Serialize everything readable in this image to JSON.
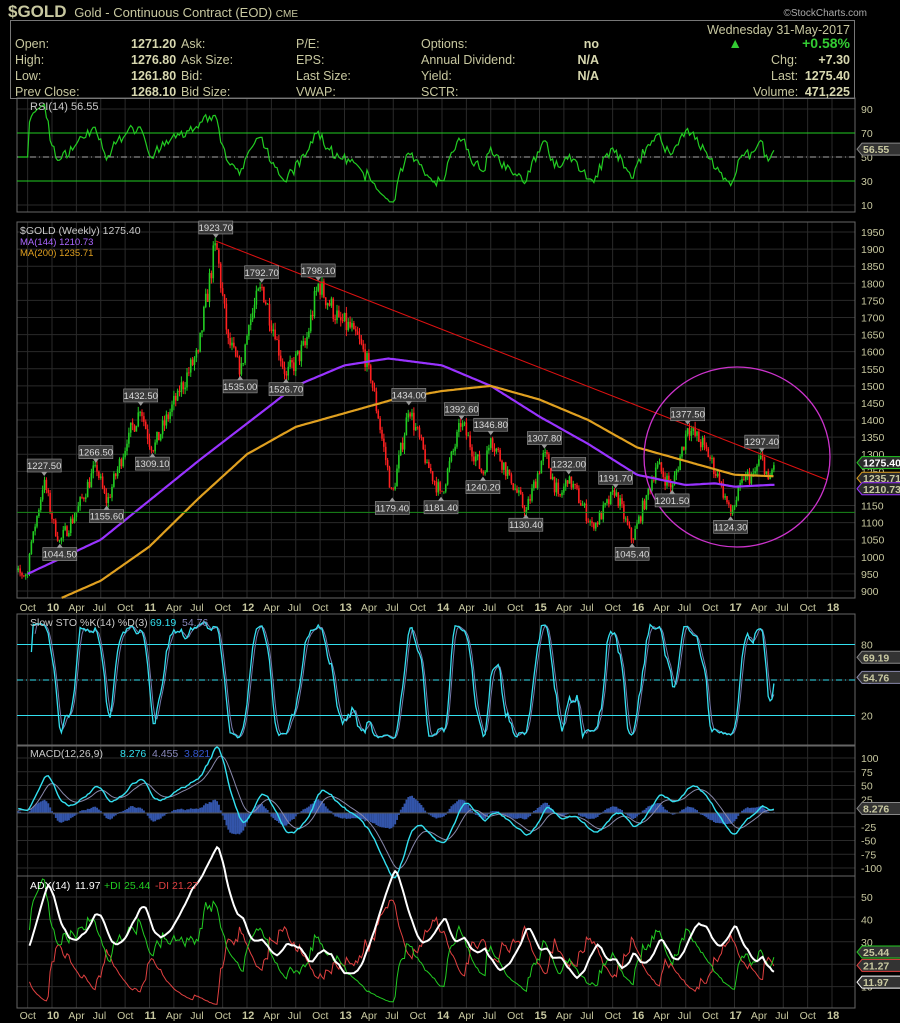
{
  "header": {
    "symbol": "$GOLD",
    "name": "Gold - Continuous Contract (EOD)",
    "exchange": "CME",
    "brand": "©StockCharts.com",
    "date": "Wednesday  31-May-2017",
    "pct_change": "+0.58%",
    "fields": [
      {
        "label": "Open:",
        "value": "1271.20"
      },
      {
        "label": "High:",
        "value": "1276.80"
      },
      {
        "label": "Low:",
        "value": "1261.80"
      },
      {
        "label": "Prev Close:",
        "value": "1268.10"
      },
      {
        "label": "Ask:",
        "value": ""
      },
      {
        "label": "Ask Size:",
        "value": ""
      },
      {
        "label": "Bid:",
        "value": ""
      },
      {
        "label": "Bid Size:",
        "value": ""
      },
      {
        "label": "P/E:",
        "value": ""
      },
      {
        "label": "EPS:",
        "value": ""
      },
      {
        "label": "Last Size:",
        "value": ""
      },
      {
        "label": "VWAP:",
        "value": ""
      },
      {
        "label": "Options:",
        "value": "no"
      },
      {
        "label": "Annual Dividend:",
        "value": "N/A"
      },
      {
        "label": "Yield:",
        "value": "N/A"
      },
      {
        "label": "SCTR:",
        "value": ""
      },
      {
        "label": "Chg:",
        "value": "+7.30"
      },
      {
        "label": "Last:",
        "value": "1275.40"
      },
      {
        "label": "Volume:",
        "value": "471,225"
      }
    ]
  },
  "colors": {
    "up": "#22cc22",
    "down": "#ff2020",
    "ma144": "#9933ff",
    "ma200": "#e0a020",
    "rsi": "#22cc22",
    "sto": "#33e0f0",
    "macd": "#33e0f0",
    "hist": "#3355aa",
    "adx": "#ffffff",
    "pdi": "#22cc22",
    "mdi": "#e04040",
    "trend": "#dd1111",
    "circle": "#cc33cc"
  },
  "chart_data": {
    "type": "line",
    "title": "$GOLD (Weekly) 1275.40",
    "x_ticks": [
      {
        "t": 2009.75,
        "label": "Oct"
      },
      {
        "t": 2010.0,
        "label": "10"
      },
      {
        "t": 2010.25,
        "label": "Apr"
      },
      {
        "t": 2010.5,
        "label": "Jul"
      },
      {
        "t": 2010.75,
        "label": "Oct"
      },
      {
        "t": 2011.0,
        "label": "11"
      },
      {
        "t": 2011.25,
        "label": "Apr"
      },
      {
        "t": 2011.5,
        "label": "Jul"
      },
      {
        "t": 2011.75,
        "label": "Oct"
      },
      {
        "t": 2012.0,
        "label": "12"
      },
      {
        "t": 2012.25,
        "label": "Apr"
      },
      {
        "t": 2012.5,
        "label": "Jul"
      },
      {
        "t": 2012.75,
        "label": "Oct"
      },
      {
        "t": 2013.0,
        "label": "13"
      },
      {
        "t": 2013.25,
        "label": "Apr"
      },
      {
        "t": 2013.5,
        "label": "Jul"
      },
      {
        "t": 2013.75,
        "label": "Oct"
      },
      {
        "t": 2014.0,
        "label": "14"
      },
      {
        "t": 2014.25,
        "label": "Apr"
      },
      {
        "t": 2014.5,
        "label": "Jul"
      },
      {
        "t": 2014.75,
        "label": "Oct"
      },
      {
        "t": 2015.0,
        "label": "15"
      },
      {
        "t": 2015.25,
        "label": "Apr"
      },
      {
        "t": 2015.5,
        "label": "Jul"
      },
      {
        "t": 2015.75,
        "label": "Oct"
      },
      {
        "t": 2016.0,
        "label": "16"
      },
      {
        "t": 2016.25,
        "label": "Apr"
      },
      {
        "t": 2016.5,
        "label": "Jul"
      },
      {
        "t": 2016.75,
        "label": "Oct"
      },
      {
        "t": 2017.0,
        "label": "17"
      },
      {
        "t": 2017.25,
        "label": "Apr"
      },
      {
        "t": 2017.5,
        "label": "Jul"
      },
      {
        "t": 2017.75,
        "label": "Oct"
      },
      {
        "t": 2018.0,
        "label": "18"
      }
    ],
    "panels": {
      "rsi": {
        "legend": "RSI(14) 56.55",
        "ticks": [
          90,
          70,
          50,
          30,
          10
        ],
        "last": "56.55",
        "ylim": [
          0,
          100
        ]
      },
      "price": {
        "legend": "$GOLD (Weekly) 1275.40",
        "ma144_legend": "MA(144) 1210.73",
        "ma200_legend": "MA(200) 1235.71",
        "ticks": [
          1950,
          1900,
          1850,
          1800,
          1750,
          1700,
          1650,
          1600,
          1550,
          1500,
          1450,
          1400,
          1350,
          1300,
          1250,
          1200,
          1150,
          1100,
          1050,
          1000,
          950,
          900
        ],
        "ylim": [
          880,
          1960
        ],
        "last_labels": {
          "close": "1275.40",
          "ma200": "1235.71",
          "ma144": "1210.73"
        },
        "closes_key": [
          [
            2009.75,
            1000
          ],
          [
            2009.82,
            1080
          ],
          [
            2009.92,
            1227.5
          ],
          [
            2010.0,
            1110
          ],
          [
            2010.08,
            1044.5
          ],
          [
            2010.25,
            1130
          ],
          [
            2010.45,
            1266.5
          ],
          [
            2010.56,
            1155.6
          ],
          [
            2010.78,
            1350
          ],
          [
            2010.91,
            1432.5
          ],
          [
            2011.03,
            1309.1
          ],
          [
            2011.3,
            1480
          ],
          [
            2011.5,
            1600
          ],
          [
            2011.68,
            1923.7
          ],
          [
            2011.8,
            1640
          ],
          [
            2011.93,
            1535
          ],
          [
            2012.02,
            1680
          ],
          [
            2012.15,
            1792.7
          ],
          [
            2012.3,
            1640
          ],
          [
            2012.4,
            1526.7
          ],
          [
            2012.6,
            1620
          ],
          [
            2012.73,
            1798.1
          ],
          [
            2012.95,
            1690
          ],
          [
            2013.1,
            1660
          ],
          [
            2013.25,
            1560
          ],
          [
            2013.35,
            1400
          ],
          [
            2013.49,
            1179.4
          ],
          [
            2013.66,
            1434
          ],
          [
            2013.85,
            1270
          ],
          [
            2013.99,
            1181.4
          ],
          [
            2014.2,
            1392.6
          ],
          [
            2014.42,
            1240.2
          ],
          [
            2014.5,
            1346.8
          ],
          [
            2014.7,
            1230
          ],
          [
            2014.86,
            1130.4
          ],
          [
            2015.05,
            1307.8
          ],
          [
            2015.2,
            1170
          ],
          [
            2015.3,
            1232
          ],
          [
            2015.55,
            1085
          ],
          [
            2015.78,
            1191.7
          ],
          [
            2015.95,
            1045.4
          ],
          [
            2016.1,
            1180
          ],
          [
            2016.2,
            1270
          ],
          [
            2016.36,
            1201.5
          ],
          [
            2016.52,
            1377.5
          ],
          [
            2016.7,
            1320
          ],
          [
            2016.85,
            1220
          ],
          [
            2016.96,
            1124.3
          ],
          [
            2017.1,
            1230
          ],
          [
            2017.2,
            1240
          ],
          [
            2017.28,
            1297.4
          ],
          [
            2017.35,
            1220
          ],
          [
            2017.41,
            1275.4
          ]
        ],
        "ma144_key": [
          [
            2009.75,
            950
          ],
          [
            2010.5,
            1050
          ],
          [
            2011.5,
            1280
          ],
          [
            2012.5,
            1500
          ],
          [
            2013.0,
            1560
          ],
          [
            2013.45,
            1580
          ],
          [
            2014.0,
            1560
          ],
          [
            2014.5,
            1500
          ],
          [
            2015.0,
            1410
          ],
          [
            2015.5,
            1330
          ],
          [
            2016.0,
            1240
          ],
          [
            2016.5,
            1210
          ],
          [
            2016.8,
            1215
          ],
          [
            2017.0,
            1205
          ],
          [
            2017.41,
            1210.73
          ]
        ],
        "ma200_key": [
          [
            2010.1,
            880
          ],
          [
            2010.5,
            930
          ],
          [
            2011.0,
            1030
          ],
          [
            2011.5,
            1170
          ],
          [
            2012.0,
            1300
          ],
          [
            2012.5,
            1380
          ],
          [
            2013.0,
            1420
          ],
          [
            2013.5,
            1460
          ],
          [
            2014.0,
            1485
          ],
          [
            2014.5,
            1500
          ],
          [
            2015.0,
            1460
          ],
          [
            2015.5,
            1400
          ],
          [
            2016.0,
            1320
          ],
          [
            2016.5,
            1280
          ],
          [
            2017.0,
            1240
          ],
          [
            2017.41,
            1235.71
          ]
        ],
        "trendline": [
          [
            2011.68,
            1923.7
          ],
          [
            2017.95,
            1225
          ]
        ],
        "support_line": 1130,
        "annotations": [
          {
            "t": 2009.92,
            "v": 1227.5,
            "label": "1227.50",
            "pos": "above"
          },
          {
            "t": 2010.08,
            "v": 1044.5,
            "label": "1044.50",
            "pos": "below"
          },
          {
            "t": 2010.45,
            "v": 1266.5,
            "label": "1266.50",
            "pos": "above"
          },
          {
            "t": 2010.56,
            "v": 1155.6,
            "label": "1155.60",
            "pos": "below"
          },
          {
            "t": 2010.91,
            "v": 1432.5,
            "label": "1432.50",
            "pos": "above"
          },
          {
            "t": 2011.03,
            "v": 1309.1,
            "label": "1309.10",
            "pos": "below"
          },
          {
            "t": 2011.68,
            "v": 1923.7,
            "label": "1923.70",
            "pos": "above"
          },
          {
            "t": 2011.93,
            "v": 1535,
            "label": "1535.00",
            "pos": "below"
          },
          {
            "t": 2012.15,
            "v": 1792.7,
            "label": "1792.70",
            "pos": "above"
          },
          {
            "t": 2012.4,
            "v": 1526.7,
            "label": "1526.70",
            "pos": "below"
          },
          {
            "t": 2012.73,
            "v": 1798.1,
            "label": "1798.10",
            "pos": "above"
          },
          {
            "t": 2013.49,
            "v": 1179.4,
            "label": "1179.40",
            "pos": "below"
          },
          {
            "t": 2013.66,
            "v": 1434,
            "label": "1434.00",
            "pos": "above"
          },
          {
            "t": 2013.99,
            "v": 1181.4,
            "label": "1181.40",
            "pos": "below"
          },
          {
            "t": 2014.2,
            "v": 1392.6,
            "label": "1392.60",
            "pos": "above"
          },
          {
            "t": 2014.42,
            "v": 1240.2,
            "label": "1240.20",
            "pos": "below"
          },
          {
            "t": 2014.5,
            "v": 1346.8,
            "label": "1346.80",
            "pos": "above"
          },
          {
            "t": 2014.86,
            "v": 1130.4,
            "label": "1130.40",
            "pos": "below"
          },
          {
            "t": 2015.05,
            "v": 1307.8,
            "label": "1307.80",
            "pos": "above"
          },
          {
            "t": 2015.3,
            "v": 1232,
            "label": "1232.00",
            "pos": "above"
          },
          {
            "t": 2015.78,
            "v": 1191.7,
            "label": "1191.70",
            "pos": "above"
          },
          {
            "t": 2015.95,
            "v": 1045.4,
            "label": "1045.40",
            "pos": "below"
          },
          {
            "t": 2016.36,
            "v": 1201.5,
            "label": "1201.50",
            "pos": "below"
          },
          {
            "t": 2016.52,
            "v": 1377.5,
            "label": "1377.50",
            "pos": "above"
          },
          {
            "t": 2016.96,
            "v": 1124.3,
            "label": "1124.30",
            "pos": "below"
          },
          {
            "t": 2017.28,
            "v": 1297.4,
            "label": "1297.40",
            "pos": "above"
          }
        ]
      },
      "sto": {
        "legend_name": "Slow STO %K(14) %D(3)",
        "k": "69.19",
        "d": "54.76",
        "ticks": [
          80,
          50,
          20
        ],
        "ylim": [
          -5,
          105
        ]
      },
      "macd": {
        "legend_name": "MACD(12,26,9)",
        "macd": "8.276",
        "signal": "4.455",
        "hist": "3.821",
        "ticks": [
          100,
          75,
          50,
          25,
          -25,
          -50,
          -75,
          -100
        ],
        "last": "8.276",
        "ylim": [
          -115,
          115
        ]
      },
      "adx": {
        "legend_name": "ADX(14)",
        "adx": "11.97",
        "pdi_label": "+DI",
        "pdi": "25.44",
        "mdi_label": "-DI",
        "mdi": "21.27",
        "ticks": [
          50,
          40,
          30,
          20,
          10
        ],
        "ylim": [
          0,
          55
        ]
      }
    }
  }
}
